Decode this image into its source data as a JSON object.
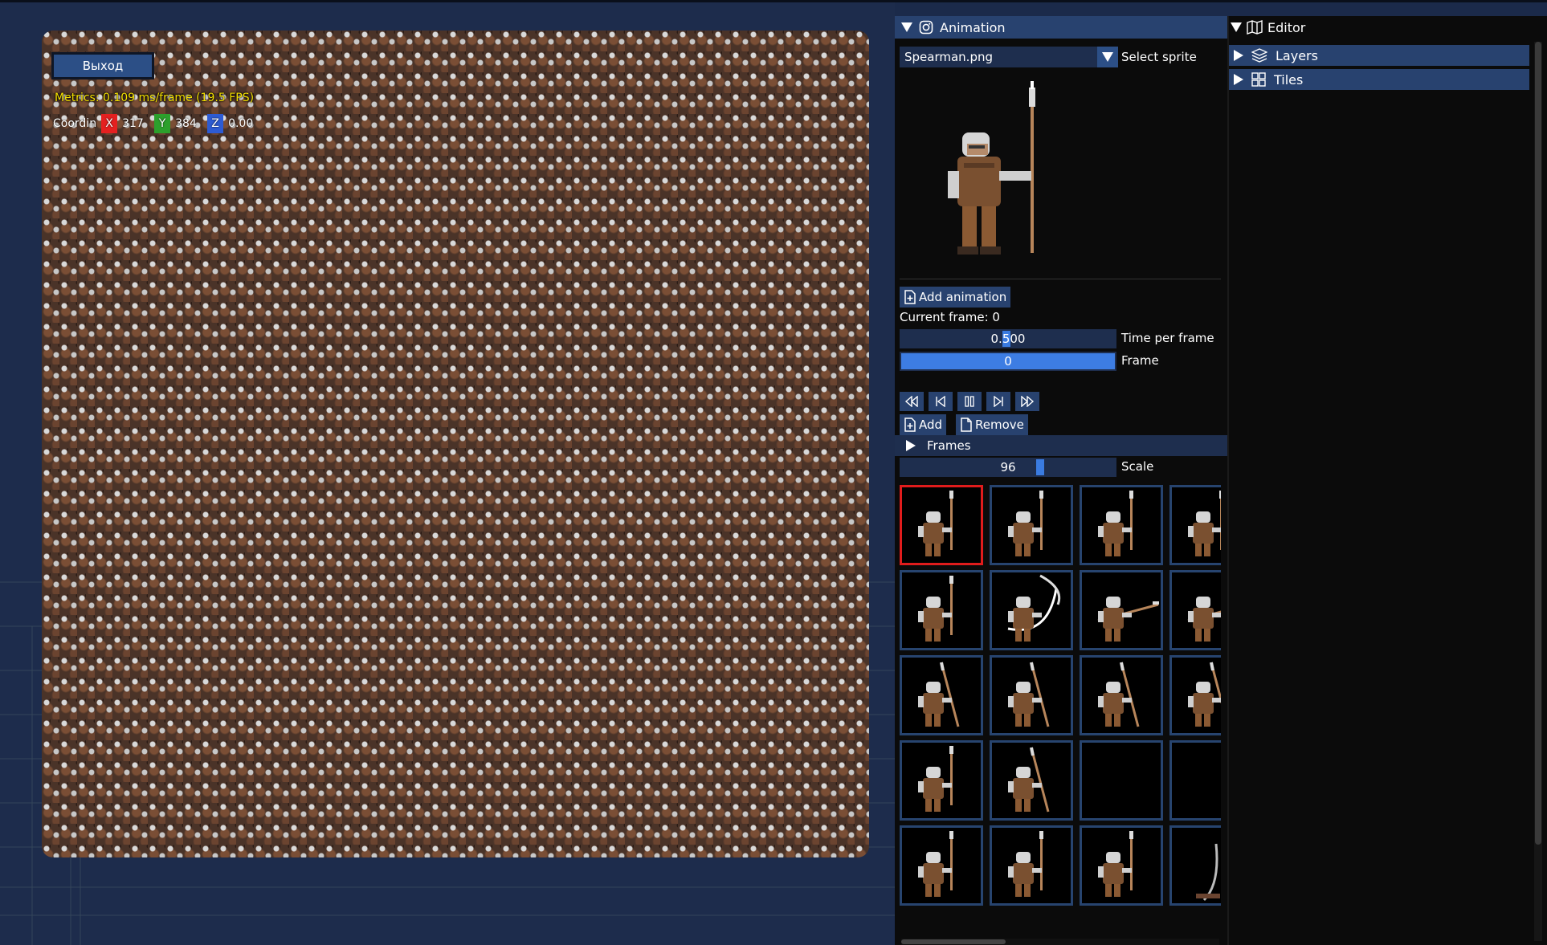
{
  "viewport": {
    "exit_button": "Выход",
    "metrics": "Metrics: 0.109 ms/frame (19.5 FPS)",
    "coords": {
      "label": "Coordin",
      "x_label": "X",
      "x_value": "317",
      "y_label": "Y",
      "y_value": "384",
      "z_label": "Z",
      "z_value": "0.00"
    }
  },
  "animation": {
    "title": "Animation",
    "sprite_value": "Spearman.png",
    "sprite_label": "Select sprite",
    "add_animation": "Add animation",
    "current_frame": "Current frame: 0",
    "time_per_frame_value": "0.500",
    "time_per_frame_label": "Time per frame",
    "frame_value": "0",
    "frame_label": "Frame",
    "add_button": "Add",
    "remove_button": "Remove",
    "frames_section": "Frames",
    "scale_value": "96",
    "scale_label": "Scale",
    "frame_poses": [
      [
        "idle",
        "idle",
        "idle",
        "idle"
      ],
      [
        "idle",
        "swing",
        "thrust",
        "thrust"
      ],
      [
        "lean",
        "lean",
        "lean",
        "lean"
      ],
      [
        "idle",
        "lean",
        "empty",
        "empty"
      ],
      [
        "idle",
        "idle",
        "idle",
        "arc"
      ]
    ]
  },
  "editor": {
    "title": "Editor",
    "items": [
      {
        "label": "Layers",
        "icon": "layers-icon"
      },
      {
        "label": "Tiles",
        "icon": "grid-icon"
      }
    ]
  },
  "colors": {
    "accent": "#28426f",
    "slider_fill": "#3d7de3",
    "metrics_text": "#f4e000",
    "selected_frame": "#e11c1c",
    "axis_x": "#e52020",
    "axis_y": "#2ca02c",
    "axis_z": "#2d5bd3"
  }
}
